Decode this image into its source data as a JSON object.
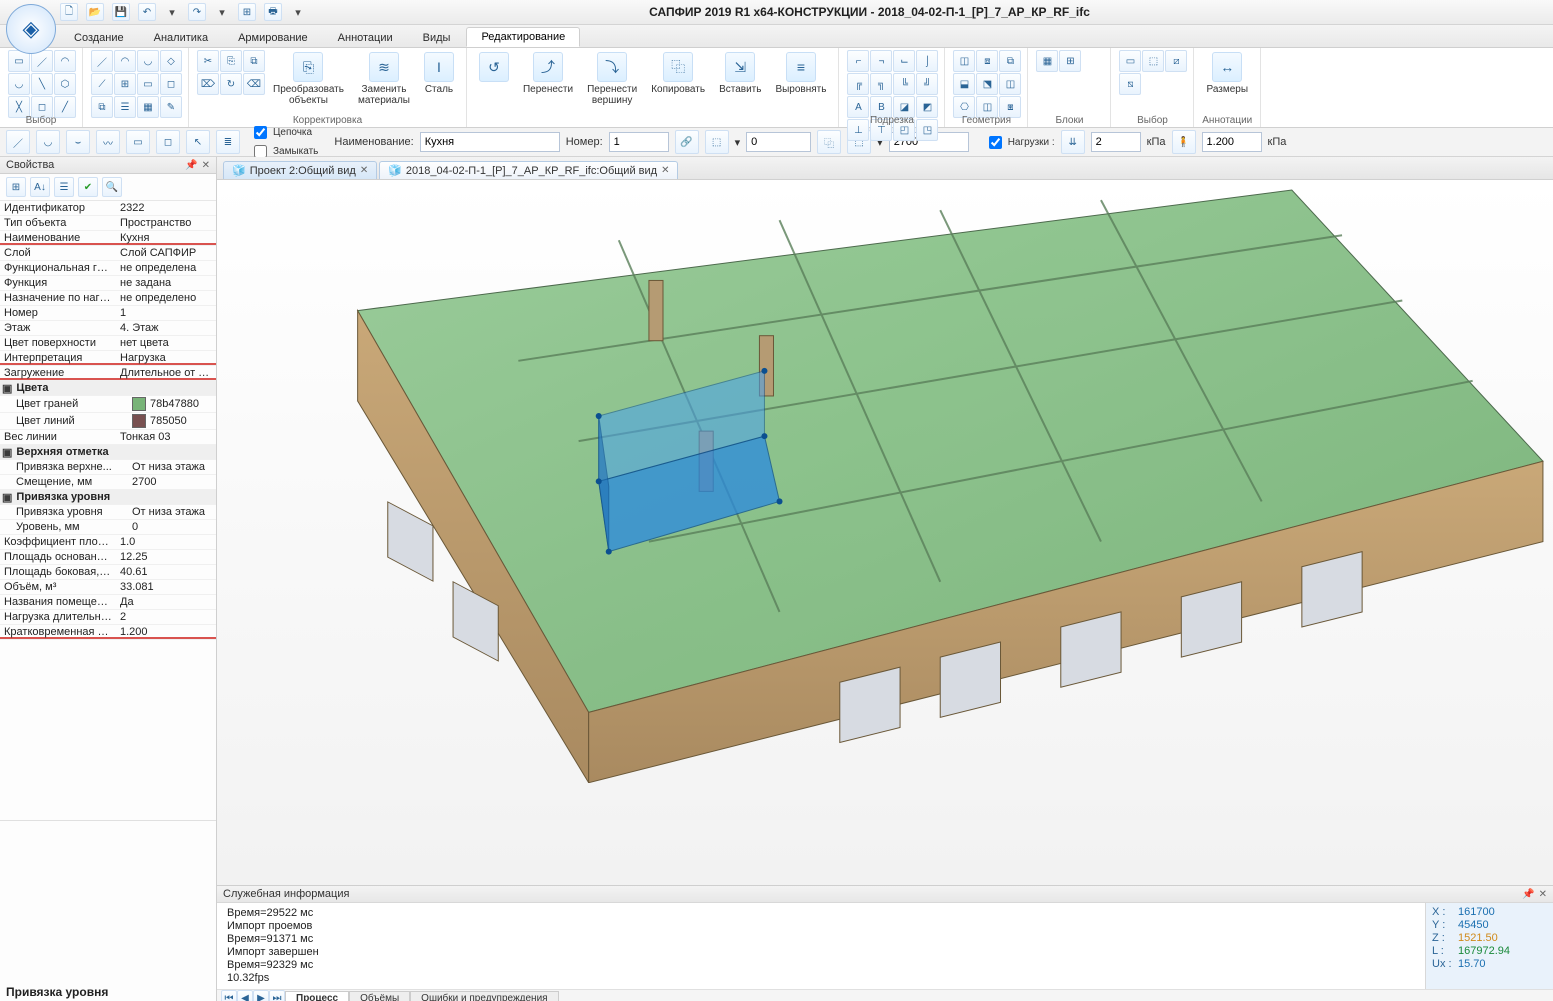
{
  "app": {
    "title": "САПФИР 2019 R1 x64-КОНСТРУКЦИИ - 2018_04-02-П-1_[Р]_7_АР_КР_RF_ifc",
    "qat": [
      "new-doc",
      "open",
      "save",
      "undo",
      "undo-dd",
      "redo",
      "redo-dd",
      "grid",
      "print",
      "more"
    ]
  },
  "menu": {
    "tabs": [
      "Создание",
      "Аналитика",
      "Армирование",
      "Аннотации",
      "Виды",
      "Редактирование"
    ],
    "active": 5
  },
  "ribbon": {
    "groups": [
      {
        "title": "Выбор",
        "big": [],
        "grid": [
          "▭",
          "／",
          "◠",
          "◡",
          "╲",
          "⬡",
          "╳",
          "◻",
          "╱"
        ]
      },
      {
        "title": "",
        "big": [],
        "grid": [
          "／",
          "◠",
          "◡",
          "◇",
          "⟋",
          "⊞",
          "▭",
          "◻",
          "⧉",
          "☰",
          "▦",
          "✎"
        ]
      },
      {
        "title": "Корректировка",
        "big": [
          {
            "icon": "⎘",
            "label": "Преобразовать\nобъекты"
          },
          {
            "icon": "≋",
            "label": "Заменить\nматериалы"
          },
          {
            "icon": "I",
            "label": "Сталь"
          }
        ],
        "grid": [
          "✂",
          "⎘",
          "⧉",
          "⌦",
          "↻",
          "⌫"
        ]
      },
      {
        "title": "",
        "big": [
          {
            "icon": "↺",
            "label": ""
          },
          {
            "icon": "⤴",
            "label": "Перенести"
          },
          {
            "icon": "⤵",
            "label": "Перенести\nвершину"
          },
          {
            "icon": "⿻",
            "label": "Копировать"
          },
          {
            "icon": "⇲",
            "label": "Вставить"
          },
          {
            "icon": "≡",
            "label": "Выровнять"
          }
        ],
        "grid": []
      },
      {
        "title": "Подрезка",
        "big": [],
        "grid": [
          "⌐",
          "¬",
          "⌙",
          "⌡",
          "╔",
          "╗",
          "╚",
          "╝",
          "A",
          "B",
          "◪",
          "◩",
          "⊥",
          "⊤",
          "◰",
          "◳"
        ]
      },
      {
        "title": "Геометрия",
        "big": [],
        "grid": [
          "◫",
          "⧈",
          "⧉",
          "⬓",
          "⬔",
          "◫",
          "⎔",
          "◫",
          "⧆"
        ]
      },
      {
        "title": "Блоки",
        "big": [],
        "grid": [
          "▦",
          "⊞"
        ]
      },
      {
        "title": "Выбор",
        "big": [],
        "grid": [
          "▭",
          "⬚",
          "⧄",
          "⧅"
        ]
      },
      {
        "title": "Аннотации",
        "big": [
          {
            "icon": "↔",
            "label": "Размеры"
          }
        ],
        "grid": []
      }
    ]
  },
  "optbar": {
    "chain": "Цепочка",
    "close": "Замыкать",
    "name_label": "Наименование:",
    "name_value": "Кухня",
    "num_label": "Номер:",
    "num_value": "1",
    "height_value": "0",
    "level_value": "2700",
    "loads_chk": "Нагрузки :",
    "load_long": "2",
    "load_long_unit": "кПа",
    "load_short": "1.200",
    "load_short_unit": "кПа"
  },
  "doctabs": [
    {
      "label": "Проект 2:Общий вид",
      "active": false
    },
    {
      "label": "2018_04-02-П-1_[Р]_7_АР_КР_RF_ifc:Общий вид",
      "active": true
    }
  ],
  "props": {
    "title": "Свойства",
    "hint": "Привязка уровня",
    "rows": [
      {
        "k": "Идентификатор",
        "v": "2322"
      },
      {
        "k": "Тип объекта",
        "v": "Пространство"
      },
      {
        "k": "Наименование",
        "v": "Кухня",
        "u": true
      },
      {
        "k": "Слой",
        "v": "Слой САПФИР"
      },
      {
        "k": "Функциональная гр...",
        "v": "не определена"
      },
      {
        "k": "Функция",
        "v": "не задана"
      },
      {
        "k": "Назначение по нагр...",
        "v": "не определено"
      },
      {
        "k": "Номер",
        "v": "1"
      },
      {
        "k": "Этаж",
        "v": "4. Этаж"
      },
      {
        "k": "Цвет поверхности",
        "v": "нет цвета"
      },
      {
        "k": "Интерпретация",
        "v": "Нагрузка",
        "u": true
      },
      {
        "k": "Загружение",
        "v": "Длительное от поме...",
        "u": true
      },
      {
        "group": "Цвета"
      },
      {
        "k": "Цвет граней",
        "v": "78b47880",
        "swatch": "#78b478",
        "indent": true
      },
      {
        "k": "Цвет линий",
        "v": "785050",
        "swatch": "#785050",
        "indent": true
      },
      {
        "k": "Вес линии",
        "v": "Тонкая 03"
      },
      {
        "group": "Верхняя отметка"
      },
      {
        "k": "Привязка верхне...",
        "v": "От низа этажа",
        "indent": true
      },
      {
        "k": "Смещение, мм",
        "v": "2700",
        "indent": true
      },
      {
        "group": "Привязка уровня"
      },
      {
        "k": "Привязка уровня",
        "v": "От низа этажа",
        "indent": true
      },
      {
        "k": "Уровень, мм",
        "v": "0",
        "indent": true
      },
      {
        "k": "Коэффициент площ...",
        "v": "1.0"
      },
      {
        "k": "Площадь основания...",
        "v": "12.25"
      },
      {
        "k": "Площадь боковая, м²",
        "v": "40.61"
      },
      {
        "k": "Объём, м³",
        "v": "33.081"
      },
      {
        "k": "Названия помещений",
        "v": "Да"
      },
      {
        "k": "Нагрузка длительна...",
        "v": "2"
      },
      {
        "k": "Кратковременная н...",
        "v": "1.200",
        "u": true
      }
    ]
  },
  "log": {
    "title": "Служебная информация",
    "lines": [
      "Время=29522 мс",
      "Импорт проемов",
      "Время=91371 мс",
      "Импорт завершен",
      "Время=92329 мс",
      "  10.32fps"
    ],
    "coords": [
      {
        "k": "X :",
        "v": "161700",
        "c": "#1a6fb0"
      },
      {
        "k": "Y :",
        "v": "45450",
        "c": "#1a6fb0"
      },
      {
        "k": "Z :",
        "v": "1521.50",
        "c": "#d08a1a"
      },
      {
        "k": "L :",
        "v": "167972.94",
        "c": "#1a8a3a"
      },
      {
        "k": "Ux :",
        "v": "15.70",
        "c": "#1a6fb0"
      }
    ],
    "tabs": [
      "Процесс",
      "Объёмы",
      "Ошибки и предупреждения"
    ],
    "active": 0
  }
}
